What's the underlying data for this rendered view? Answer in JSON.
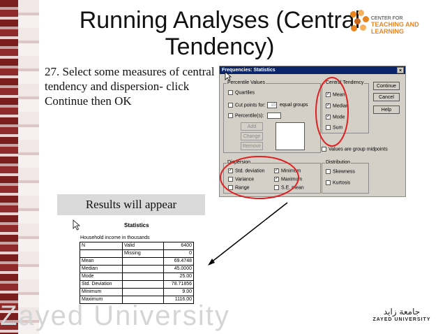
{
  "slide": {
    "title": "Running Analyses (Central Tendency)",
    "instruction": "27. Select some measures of central tendency and dispersion- click Continue then OK",
    "results_note": "Results will appear",
    "brand_header_small": "CENTER FOR",
    "brand_header_main": "TEACHING AND LEARNING",
    "footer_brand": "Zayed University",
    "footer_logo_arabic": "جامعة زايد",
    "footer_logo_latin": "ZAYED UNIVERSITY"
  },
  "dialog": {
    "title": "Frequencies: Statistics",
    "close_glyph": "×",
    "percentile_values": {
      "label": "Percentile Values",
      "quartiles": "Quartiles",
      "cut_points": "Cut points for:",
      "cut_points_value": "10",
      "equal_groups": "equal groups",
      "percentiles": "Percentile(s):",
      "add": "Add",
      "change": "Change",
      "remove": "Remove"
    },
    "central_tendency": {
      "label": "Central Tendency",
      "mean": "Mean",
      "median": "Median",
      "mode": "Mode",
      "sum": "Sum"
    },
    "buttons": {
      "continue": "Continue",
      "cancel": "Cancel",
      "help": "Help"
    },
    "group_midpoints": "Values are group midpoints",
    "dispersion": {
      "label": "Dispersion",
      "std_deviation": "Std. deviation",
      "minimum": "Minimum",
      "variance": "Variance",
      "maximum": "Maximum",
      "range": "Range",
      "se_mean": "S.E. mean"
    },
    "distribution": {
      "label": "Distribution",
      "skewness": "Skewness",
      "kurtosis": "Kurtosis"
    },
    "check": "✓"
  },
  "output": {
    "title": "Statistics",
    "variable": "Household income in thousands",
    "rows": [
      {
        "label": "N",
        "sub": "Valid",
        "value": "6400"
      },
      {
        "label": "",
        "sub": "Missing",
        "value": "0"
      },
      {
        "label": "Mean",
        "sub": "",
        "value": "69.4748"
      },
      {
        "label": "Median",
        "sub": "",
        "value": "45.0000"
      },
      {
        "label": "Mode",
        "sub": "",
        "value": "25.00"
      },
      {
        "label": "Std. Deviation",
        "sub": "",
        "value": "78.71856"
      },
      {
        "label": "Minimum",
        "sub": "",
        "value": "9.00"
      },
      {
        "label": "Maximum",
        "sub": "",
        "value": "1116.00"
      }
    ]
  },
  "colors": {
    "highlight_circle": "#e02020",
    "titlebar": "#0a246a",
    "dialog_bg": "#d4d0c8",
    "brand_orange": "#e7841f"
  }
}
